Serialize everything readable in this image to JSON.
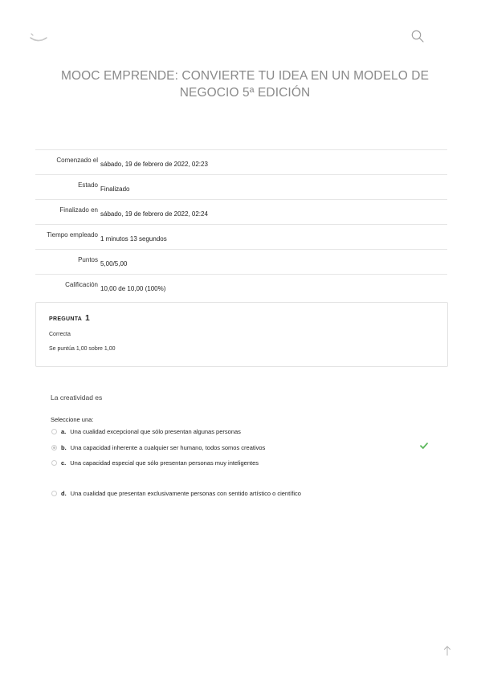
{
  "header": {
    "logo_icon": "smile-logo-icon",
    "search_icon": "search-icon",
    "course_title": "MOOC EMPRENDE: CONVIERTE TU IDEA EN UN MODELO DE NEGOCIO 5ª EDICIÓN"
  },
  "summary": [
    {
      "label": "Comenzado el",
      "value": "sábado, 19 de febrero de 2022, 02:23"
    },
    {
      "label": "Estado",
      "value": "Finalizado"
    },
    {
      "label": "Finalizado en",
      "value": "sábado, 19 de febrero de 2022, 02:24"
    },
    {
      "label": "Tiempo empleado",
      "value": "1 minutos 13 segundos"
    },
    {
      "label": "Puntos",
      "value": "5,00/5,00"
    },
    {
      "label": "Calificación",
      "value": "10,00 de 10,00 (100%)"
    }
  ],
  "question": {
    "title_prefix": "PREGUNTA",
    "number": "1",
    "status": "Correcta",
    "grade": "Se puntúa 1,00 sobre 1,00",
    "text": "La creatividad es",
    "prompt": "Seleccione una:",
    "answers": [
      {
        "letter": "a.",
        "text": "Una cualidad excepcional que sólo presentan algunas personas",
        "selected": false
      },
      {
        "letter": "b.",
        "text": "Una capacidad inherente a cualquier ser humano, todos somos creativos",
        "selected": true
      },
      {
        "letter": "c.",
        "text": "Una capacidad especial que sólo presentan personas muy inteligentes",
        "selected": false
      },
      {
        "letter": "d.",
        "text": "Una cualidad que presentan exclusivamente personas con sentido artístico o científico",
        "selected": false
      }
    ],
    "correct_icon": "check-icon",
    "correct_color": "#5cb85c"
  },
  "footer": {
    "back_to_top_icon": "arrow-up-icon"
  }
}
